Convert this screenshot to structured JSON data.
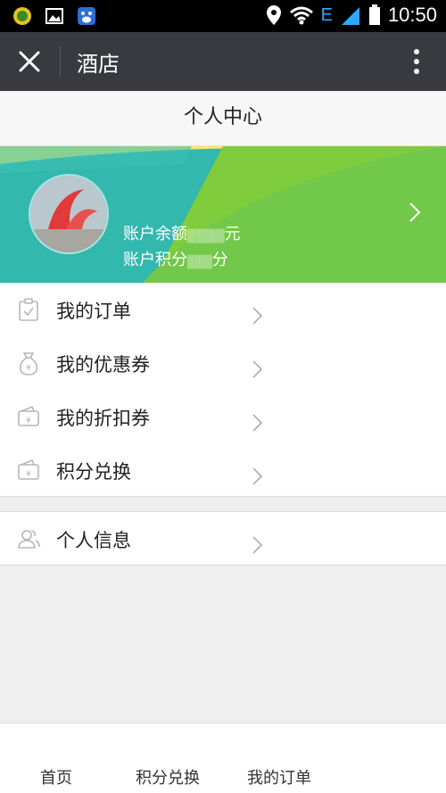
{
  "titlebar": {
    "title": "酒店"
  },
  "status": {
    "time": "10:50",
    "network": "E"
  },
  "page": {
    "header": "个人中心"
  },
  "account": {
    "balance_label": "账户余额",
    "balance_unit": "元",
    "points_label": "账户积分",
    "points_unit": "分"
  },
  "menu": [
    {
      "label": "我的订单",
      "icon": "clipboard-icon"
    },
    {
      "label": "我的优惠券",
      "icon": "money-bag-icon"
    },
    {
      "label": "我的折扣券",
      "icon": "wallet-icon"
    },
    {
      "label": "积分兑换",
      "icon": "wallet-icon"
    }
  ],
  "profile": {
    "label": "个人信息",
    "icon": "users-icon"
  },
  "tabs": [
    {
      "label": "首页"
    },
    {
      "label": "积分兑换"
    },
    {
      "label": "我的订单"
    }
  ]
}
